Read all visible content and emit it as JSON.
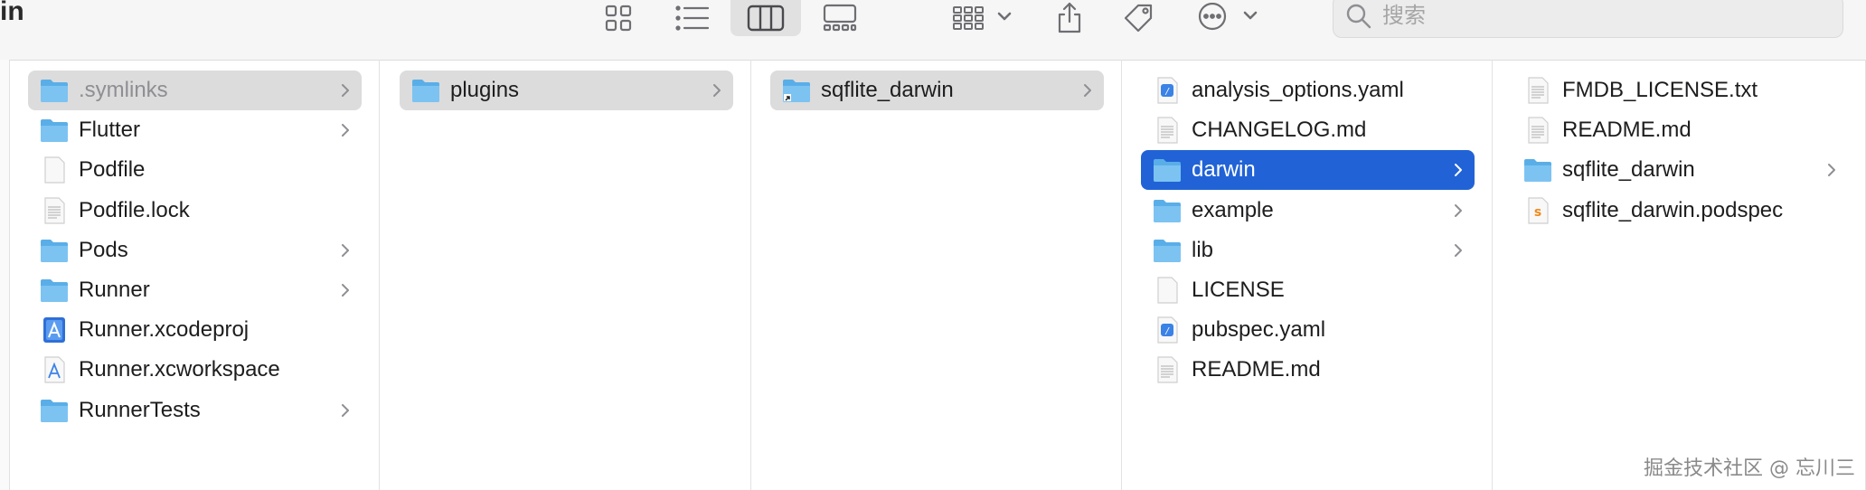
{
  "window": {
    "title_fragment": "in"
  },
  "toolbar": {
    "view_icon_grid": "icon-view-grid-icon",
    "view_list": "list-view-icon",
    "view_columns": "column-view-icon",
    "view_gallery": "gallery-view-icon",
    "group": "group-by-icon",
    "share": "share-icon",
    "tag": "tag-icon",
    "more": "more-actions-icon",
    "search_placeholder": "搜索"
  },
  "columns": [
    {
      "items": [
        {
          "label": ".symlinks",
          "icon": "folder",
          "state": "path",
          "chevron": true,
          "dim": true
        },
        {
          "label": "Flutter",
          "icon": "folder",
          "chevron": true
        },
        {
          "label": "Podfile",
          "icon": "blank-doc"
        },
        {
          "label": "Podfile.lock",
          "icon": "text-doc"
        },
        {
          "label": "Pods",
          "icon": "folder",
          "chevron": true
        },
        {
          "label": "Runner",
          "icon": "folder",
          "chevron": true
        },
        {
          "label": "Runner.xcodeproj",
          "icon": "xcodeproj"
        },
        {
          "label": "Runner.xcworkspace",
          "icon": "xcworkspace"
        },
        {
          "label": "RunnerTests",
          "icon": "folder",
          "chevron": true
        }
      ]
    },
    {
      "items": [
        {
          "label": "plugins",
          "icon": "folder",
          "state": "path",
          "chevron": true
        }
      ]
    },
    {
      "items": [
        {
          "label": "sqflite_darwin",
          "icon": "folder-alias",
          "state": "path",
          "chevron": true
        }
      ]
    },
    {
      "items": [
        {
          "label": "analysis_options.yaml",
          "icon": "yaml"
        },
        {
          "label": "CHANGELOG.md",
          "icon": "text-doc"
        },
        {
          "label": "darwin",
          "icon": "folder",
          "state": "selected",
          "chevron": true
        },
        {
          "label": "example",
          "icon": "folder",
          "chevron": true
        },
        {
          "label": "lib",
          "icon": "folder",
          "chevron": true
        },
        {
          "label": "LICENSE",
          "icon": "blank-doc"
        },
        {
          "label": "pubspec.yaml",
          "icon": "yaml"
        },
        {
          "label": "README.md",
          "icon": "text-doc"
        }
      ]
    },
    {
      "items": [
        {
          "label": "FMDB_LICENSE.txt",
          "icon": "text-doc"
        },
        {
          "label": "README.md",
          "icon": "text-doc"
        },
        {
          "label": "sqflite_darwin",
          "icon": "folder",
          "chevron": true
        },
        {
          "label": "sqflite_darwin.podspec",
          "icon": "swift-doc"
        }
      ]
    }
  ],
  "watermark": "掘金技术社区 @ 忘川三"
}
